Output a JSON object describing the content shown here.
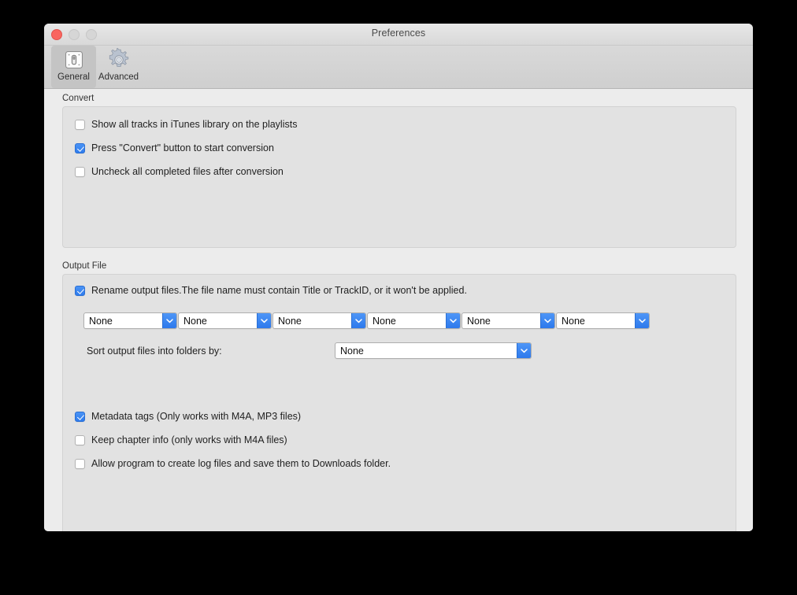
{
  "window": {
    "title": "Preferences",
    "controls": {
      "close": "close-button",
      "minimize": "minimize-button",
      "maximize": "maximize-button"
    }
  },
  "toolbar": {
    "items": [
      {
        "label": "General",
        "icon": "switch-panel-icon",
        "selected": true
      },
      {
        "label": "Advanced",
        "icon": "gear-icon",
        "selected": false
      }
    ]
  },
  "convert": {
    "group_label": "Convert",
    "checkboxes": [
      {
        "label": "Show all tracks in iTunes library on the playlists",
        "checked": false
      },
      {
        "label": "Press \"Convert\" button to start conversion",
        "checked": true
      },
      {
        "label": "Uncheck all completed files after conversion",
        "checked": false
      }
    ]
  },
  "output": {
    "group_label": "Output File",
    "rename": {
      "label": "Rename output files.The file name must contain Title or TrackID, or it won't be applied.",
      "checked": true
    },
    "name_parts": [
      {
        "value": "None"
      },
      {
        "value": "None"
      },
      {
        "value": "None"
      },
      {
        "value": "None"
      },
      {
        "value": "None"
      },
      {
        "value": "None"
      }
    ],
    "sort": {
      "label": "Sort output files into folders by:",
      "value": "None"
    },
    "checkboxes": [
      {
        "label": "Metadata tags (Only works with M4A, MP3 files)",
        "checked": true
      },
      {
        "label": "Keep chapter info (only works with  M4A files)",
        "checked": false
      },
      {
        "label": "Allow program to create log files and save them to Downloads folder.",
        "checked": false
      }
    ]
  },
  "colors": {
    "accent": "#2f7ced",
    "close_button": "#f9655f",
    "inactive_button": "#d6d6d6",
    "window_bg": "#ececec",
    "group_bg": "#e2e2e2"
  }
}
